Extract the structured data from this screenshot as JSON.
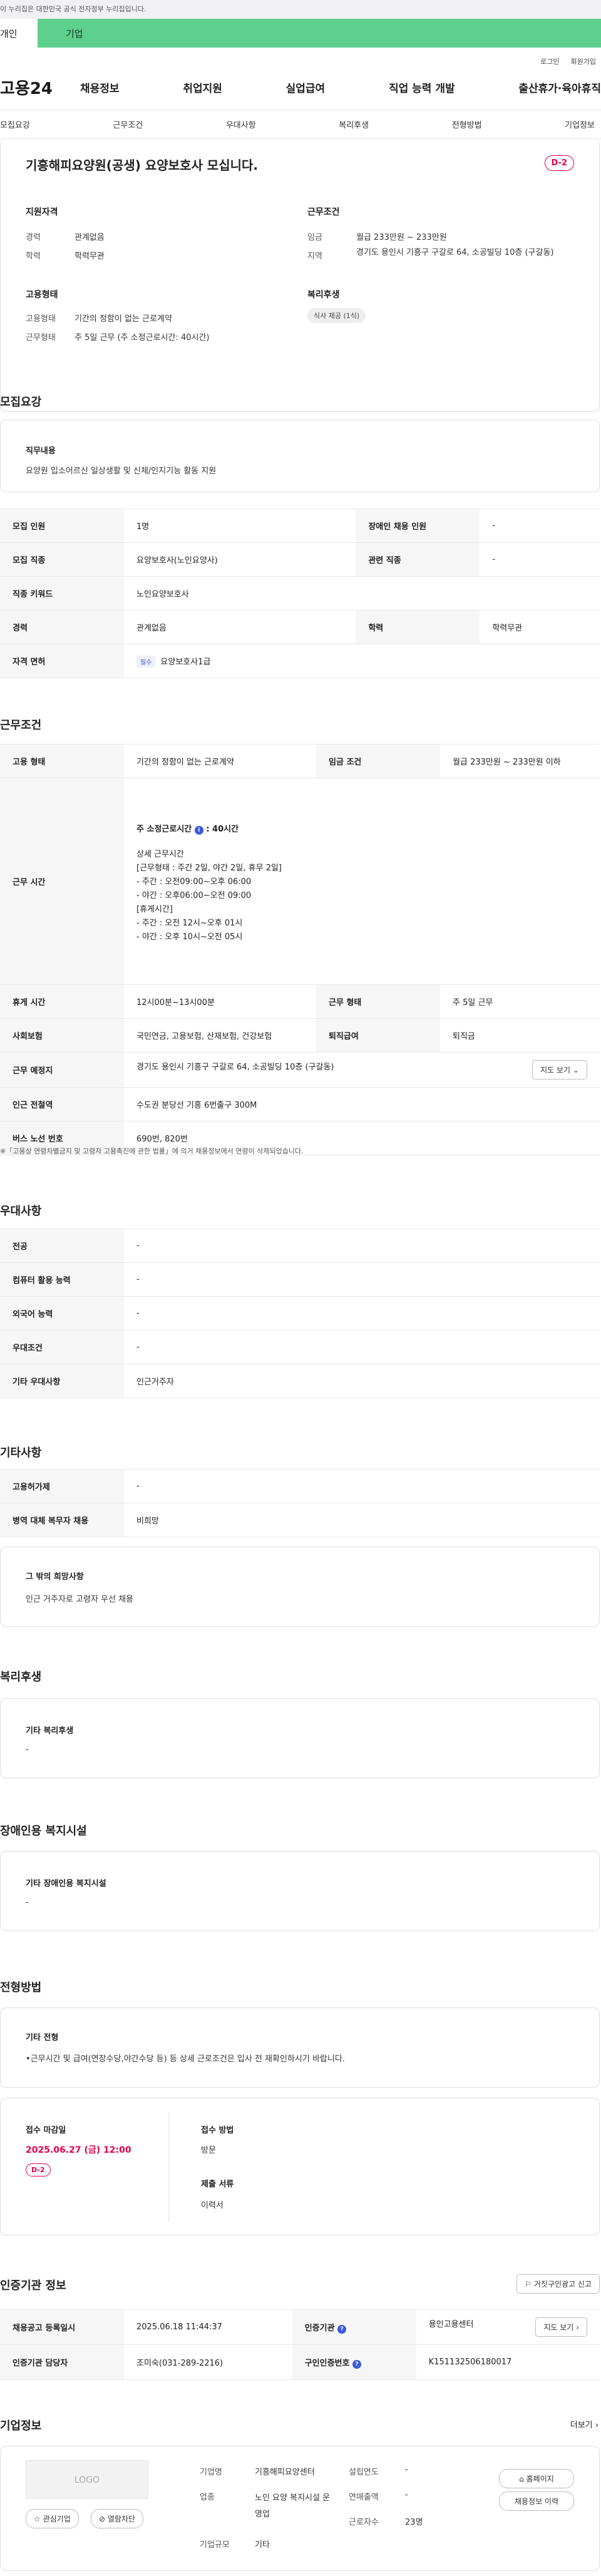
{
  "gov_banner": "이 누리집은 대한민국 공식 전자정부 누리집입니다.",
  "tabs": {
    "personal": "개인",
    "company": "기업"
  },
  "util": {
    "login": "로그인",
    "join": "회원가입"
  },
  "logo": "고용24",
  "gnb": [
    "채용정보",
    "취업지원",
    "실업급여",
    "직업 능력 개발",
    "출산휴가·육아휴직"
  ],
  "anchors": [
    "모집요강",
    "근무조건",
    "우대사항",
    "복리후생",
    "전형방법",
    "기업정보"
  ],
  "summary": {
    "title": "기흥해피요양원(공생) 요양보호사 모십니다.",
    "dday": "D-2",
    "qual_head": "지원자격",
    "career_label": "경력",
    "career": "관계없음",
    "edu_label": "학력",
    "edu": "학력무관",
    "cond_head": "근무조건",
    "wage_label": "임금",
    "wage": "월급 233만원 ~ 233만원",
    "region_label": "지역",
    "region": "경기도 용인시 기흥구 구갈로 64, 소공빌딩 10층 (구갈동)",
    "emp_head": "고용형태",
    "emp_type_label": "고용형태",
    "emp_type": "기간의 정함이 없는 근로계약",
    "work_label": "근무형태",
    "work": "주 5일 근무 (주 소정근로시간: 40시간)",
    "welfare_head": "복리후생",
    "welfare_pill": "식사 제공 (1식)"
  },
  "recruit": {
    "heading": "모집요강",
    "duty_label": "직무내용",
    "duty": "요양원 입소어르신 일상생활 및 신체/인지기능 활동 지원",
    "rows": [
      [
        "모집 인원",
        "1명",
        "장애인 채용 인원",
        "-"
      ],
      [
        "모집 직종",
        "요양보호사(노인요양사)",
        "관련 직종",
        "-"
      ],
      [
        "직종 키워드",
        "노인요양보호사",
        "",
        ""
      ],
      [
        "경력",
        "관계없음",
        "학력",
        "학력무관"
      ]
    ],
    "license_label": "자격 면허",
    "license_tag": "필수",
    "license": "요양보호사1급"
  },
  "conditions": {
    "heading": "근무조건",
    "emp_label": "고용 형태",
    "emp": "기간의 정함이 없는 근로계약",
    "wage_label": "임금 조건",
    "wage": "월급 233만원 ~ 233만원 이하",
    "hours_label": "근무 시간",
    "hours_title": "주 소정근로시간",
    "hours_value": ": 40시간",
    "hours_lines": [
      "상세 근무시간",
      "[근무형태 : 주간 2일, 야간 2일, 휴무 2일]",
      " - 주간 : 오전09:00~오후 06:00",
      " - 야간 : 오후06:00~오전 09:00",
      "[휴게시간]",
      " - 주간 : 오전 12시~오후 01시",
      " - 야간 : 오후 10시~오전 05시"
    ],
    "rows": [
      [
        "휴게 시간",
        "12시00분~13시00분",
        "근무 형태",
        "주 5일 근무"
      ],
      [
        "사회보험",
        "국민연금, 고용보험, 산재보험, 건강보험",
        "퇴직급여",
        "퇴직금"
      ]
    ],
    "place_label": "근무 예정지",
    "place": "경기도 용인시 기흥구 구갈로 64, 소공빌딩 10층 (구갈동)",
    "map_btn": "지도 보기",
    "station_label": "인근 전철역",
    "station": "수도권 분당선 기흥 6번출구 300M",
    "bus_label": "버스 노선 번호",
    "bus": "690번, 820번",
    "note": "※「고용상 연령차별금지 및 고령자 고용촉진에 관한 법률」에 의거 채용정보에서 연령이 삭제되었습니다."
  },
  "prefer": {
    "heading": "우대사항",
    "rows": [
      [
        "전공",
        "-"
      ],
      [
        "컴퓨터 활용 능력",
        "-"
      ],
      [
        "외국어 능력",
        "-"
      ],
      [
        "우대조건",
        "-"
      ],
      [
        "기타 우대사항",
        "인근거주자"
      ]
    ]
  },
  "etc": {
    "heading": "기타사항",
    "rows": [
      [
        "고용허가제",
        "-"
      ],
      [
        "병역 대체 복무자 채용",
        "비희망"
      ]
    ],
    "wish_label": "그 밖의 희망사항",
    "wish": "인근 거주자로 고령자 우선 채용"
  },
  "welfare": {
    "heading": "복리후생",
    "label": "기타 복리후생",
    "value": "-"
  },
  "disabled": {
    "heading": "장애인용 복지시설",
    "label": "기타 장애인용 복지시설",
    "value": "-"
  },
  "selection": {
    "heading": "전형방법",
    "label": "기타 전형",
    "value": "•근무시간 및 급여(연장수당,야간수당 등) 등 상세 근로조건은 입사 전 재확인하시기 바랍니다.",
    "deadline_label": "접수 마감일",
    "deadline": "2025.06.27 (금) 12:00",
    "dday": "D-2",
    "method_label": "접수 방법",
    "method": "방문",
    "docs_label": "제출 서류",
    "docs": "이력서"
  },
  "cert": {
    "heading": "인증기관 정보",
    "report_btn": "거짓구인광고 신고",
    "rows": [
      [
        "채용공고 등록일시",
        "2025.06.18 11:44:37",
        "인증기관",
        "용인고용센터"
      ],
      [
        "인증기관 담당자",
        "조미숙(031-289-2216)",
        "구인인증번호",
        "K151132506180017"
      ]
    ],
    "map_btn": "지도 보기"
  },
  "company": {
    "heading": "기업정보",
    "more": "더보기",
    "logo_text": "LOGO",
    "fav_btn": "관심기업",
    "block_btn": "열람차단",
    "name_label": "기업명",
    "name": "기흥해피요양센터",
    "industry_label": "업종",
    "industry": "노인 요양 복지시설 운영업",
    "size_label": "기업규모",
    "size": "기타",
    "founded_label": "설립연도",
    "founded": "-",
    "sales_label": "연매출액",
    "sales": "-",
    "workers_label": "근로자수",
    "workers": "23명",
    "homepage_btn": "홈페이지",
    "other_jobs_btn": "채용정보 이력"
  }
}
